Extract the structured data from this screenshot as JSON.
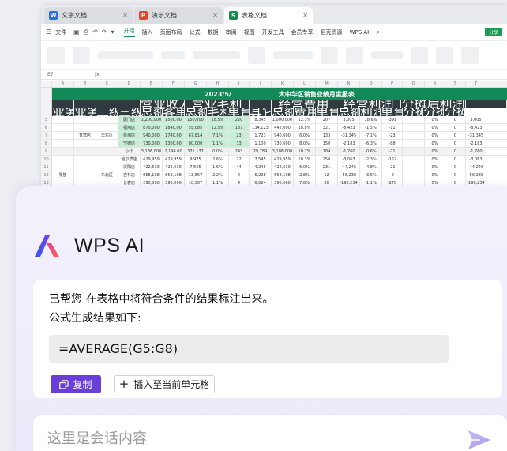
{
  "tabs": [
    {
      "label": "文字文档",
      "icon": "W",
      "color": "#2b6fe0"
    },
    {
      "label": "演示文档",
      "icon": "P",
      "color": "#e0462b"
    },
    {
      "label": "表格文档",
      "icon": "S",
      "color": "#1a8a4a"
    }
  ],
  "ribbon": {
    "file": "文件",
    "menus": [
      "开始",
      "插入",
      "页面布局",
      "公式",
      "数据",
      "审阅",
      "视图",
      "开发工具",
      "会员专享",
      "稻壳资源"
    ],
    "wps_ai": "WPS AI",
    "sync": "协作",
    "share": "分享"
  },
  "sheet": {
    "cell_ref": "E7",
    "columns": [
      "A",
      "B",
      "C",
      "D",
      "E",
      "F",
      "G",
      "H",
      "I",
      "J",
      "K",
      "L",
      "M",
      "N",
      "O",
      "P",
      "Q",
      "R",
      "S",
      "T"
    ],
    "title_date": "2023/5/",
    "title": "大中华区销售业绩月度报表",
    "headers": [
      "业务板块",
      "业务类型",
      "二级部门",
      "三级部门",
      "总额",
      "客单价",
      "总额",
      "毛利率",
      "单台毛利",
      "其它费用",
      "总额",
      "费用率",
      "单台费用",
      "总额",
      "利润率",
      "单台利润",
      "分摊费用率",
      "分摊费用/个",
      "分摊利润率"
    ],
    "group_headers": {
      "revenue": "营业收入",
      "gross": "营业毛利",
      "cost": "经营费用",
      "profit": "经营利润",
      "alloc": "分摊后利润"
    },
    "row_numbers": [
      "5",
      "6",
      "7",
      "8",
      "9",
      "10",
      "11",
      "12",
      "13",
      "14",
      "15"
    ],
    "labels": {
      "segment": "零售",
      "type": "直营店",
      "dept_a": "华东区",
      "dept_b": "东北区",
      "subtotal": "小计"
    },
    "rows": [
      [
        "厦门店",
        "1,200,000",
        "1500.00",
        "150,000",
        "18.5%",
        "220",
        "8,345",
        "1,000,000",
        "12.3%",
        "207",
        "3,005",
        "18.6%",
        "-391",
        "",
        "0%",
        "0",
        "3,005"
      ],
      [
        "福州店",
        "870,000",
        "1840.00",
        "55,085",
        "12.5%",
        "187",
        "134,123",
        "442,000",
        "18.8%",
        "321",
        "-8,423",
        "-1.5%",
        "-11",
        "",
        "0%",
        "0",
        "-8,423"
      ],
      [
        "泉州店",
        "940,000",
        "1740.00",
        "67,814",
        "7.1%",
        "23",
        "1,723",
        "940,000",
        "6.0%",
        "133",
        "-31,345",
        "-7.1%",
        "-23",
        "",
        "0%",
        "0",
        "-31,345"
      ],
      [
        "宁德店",
        "730,000",
        "1300.00",
        "80,000",
        "1.1%",
        "33",
        "1,100",
        "730,000",
        "8.0%",
        "150",
        "-2,183",
        "-6.3%",
        "-88",
        "",
        "0%",
        "0",
        "-2,183"
      ],
      [
        "小计",
        "3,186,000",
        "2,196.00",
        "371,137",
        "0.0%",
        "243",
        "29,789",
        "3,186,000",
        "10.7%",
        "784",
        "-1,760",
        "-0.6%",
        "-71",
        "",
        "0%",
        "0",
        "-1,760"
      ],
      [
        "哈尔滨店",
        "429,959",
        "429,959",
        "9,975",
        "2.6%",
        "22",
        "7,545",
        "429,959",
        "10.3%",
        "250",
        "-3,063",
        "-2.3%",
        "-162",
        "",
        "0%",
        "0",
        "-3,063"
      ],
      [
        "沈阳店",
        "422,639",
        "422,639",
        "7,565",
        "1.6%",
        "44",
        "4,246",
        "422,639",
        "6.0%",
        "231",
        "-44,246",
        "-4.8%",
        "-21",
        "",
        "0%",
        "0",
        "-44,246"
      ],
      [
        "吉林店",
        "658,108",
        "658,108",
        "13,567",
        "2.2%",
        "2",
        "6,228",
        "658,108",
        "2.8%",
        "12",
        "-56,238",
        "-3.5%",
        "-2",
        "",
        "0%",
        "0",
        "-56,238"
      ],
      [
        "长春店",
        "390,000",
        "390,000",
        "10,567",
        "1.1%",
        "4",
        "6,024",
        "390,000",
        "7.6%",
        "30",
        "-196,234",
        "-1.1%",
        "-270",
        "",
        "0%",
        "0",
        "-196,234"
      ],
      [
        "小计",
        "2,061,022",
        "2,061,022",
        "41,234",
        "1.8%",
        "18",
        "19,797",
        "2,061,022",
        "7.2%",
        "732",
        "-276,177",
        "-0.8%",
        "-752",
        "",
        "0%",
        "0",
        "-276,177"
      ],
      [
        "小计",
        "3,080,244",
        "3,080,244",
        "160,657",
        "3.7%",
        "160",
        "19,017",
        "3,080,244",
        "7.7%",
        "1,641",
        "-231,021",
        "-3.3%",
        "-887",
        "",
        "0%",
        "0",
        "-231,021"
      ]
    ]
  },
  "ai": {
    "title": "WPS AI",
    "line1": "已帮您 在表格中将符合条件的结果标注出来。",
    "line2": "公式生成结果如下:",
    "formula": "=AVERAGE(G5:G8)",
    "copy": "复制",
    "insert": "插入至当前单元格",
    "input_placeholder": "这里是会话内容"
  },
  "colors": {
    "accent": "#6a3fd9",
    "sheet_green": "#128a58"
  }
}
